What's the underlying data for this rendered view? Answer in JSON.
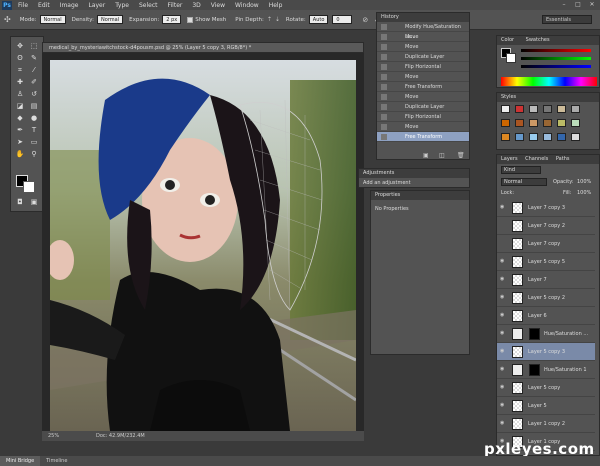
{
  "app": {
    "logo": "Ps"
  },
  "menu": [
    "File",
    "Edit",
    "Image",
    "Layer",
    "Type",
    "Select",
    "Filter",
    "3D",
    "View",
    "Window",
    "Help"
  ],
  "options_bar": {
    "mode_label": "Mode:",
    "mode_value": "Normal",
    "density_label": "Density:",
    "density_value": "Normal",
    "expansion_label": "Expansion:",
    "expansion_value": "2 px",
    "show_mesh_label": "Show Mesh",
    "pin_depth_label": "Pin Depth:",
    "rotate_label": "Rotate:",
    "rotate_value": "Auto",
    "rotate_deg": "0",
    "workspace": "Essentials"
  },
  "document": {
    "tab_title": "medical_by_mysteriawitchstock-d4pousm.psd @ 25% (Layer 5 copy 3, RGB/8*) *",
    "zoom": "25%",
    "doc_size": "Doc: 42.9M/232.4M"
  },
  "history": {
    "tab": "History",
    "items": [
      "Modify Hue/Saturation La...",
      "Move",
      "Move",
      "Duplicate Layer",
      "Flip Horizontal",
      "Move",
      "Free Transform",
      "Move",
      "Duplicate Layer",
      "Flip Horizontal",
      "Move",
      "Free Transform"
    ],
    "selected_index": 11
  },
  "adjustments": {
    "tab": "Adjustments",
    "subtitle": "Add an adjustment"
  },
  "properties": {
    "tab": "Properties",
    "text": "No Properties"
  },
  "color_panel": {
    "tabs": [
      "Color",
      "Swatches"
    ]
  },
  "styles_panel": {
    "tab": "Styles"
  },
  "layers_panel": {
    "tabs": [
      "Layers",
      "Channels",
      "Paths"
    ],
    "kind_label": "Kind",
    "blend": "Normal",
    "opacity_label": "Opacity:",
    "opacity": "100%",
    "lock_label": "Lock:",
    "fill_label": "Fill:",
    "fill": "100%",
    "layers": [
      {
        "name": "Layer 7 copy 3",
        "type": "layer"
      },
      {
        "name": "Layer 7 copy 2",
        "type": "layer"
      },
      {
        "name": "Layer 7 copy",
        "type": "layer"
      },
      {
        "name": "Layer 5 copy 5",
        "type": "layer"
      },
      {
        "name": "Layer 7",
        "type": "layer"
      },
      {
        "name": "Layer 5 copy 2",
        "type": "layer"
      },
      {
        "name": "Layer 6",
        "type": "layer"
      },
      {
        "name": "Hue/Saturation ...",
        "type": "adjustment"
      },
      {
        "name": "Layer 5 copy 3",
        "type": "layer"
      },
      {
        "name": "Hue/Saturation 1",
        "type": "adjustment"
      },
      {
        "name": "Layer 5 copy",
        "type": "layer"
      },
      {
        "name": "Layer 5",
        "type": "layer"
      },
      {
        "name": "Layer 1 copy 2",
        "type": "layer"
      },
      {
        "name": "Layer 1 copy",
        "type": "layer"
      }
    ],
    "selected_index": 8
  },
  "bottom_tabs": [
    "Mini Bridge",
    "Timeline"
  ],
  "watermark": "pxleyes.com",
  "colors": {
    "accent": "#8ea1c2",
    "panel": "#535353",
    "dark": "#3a3a3a"
  }
}
